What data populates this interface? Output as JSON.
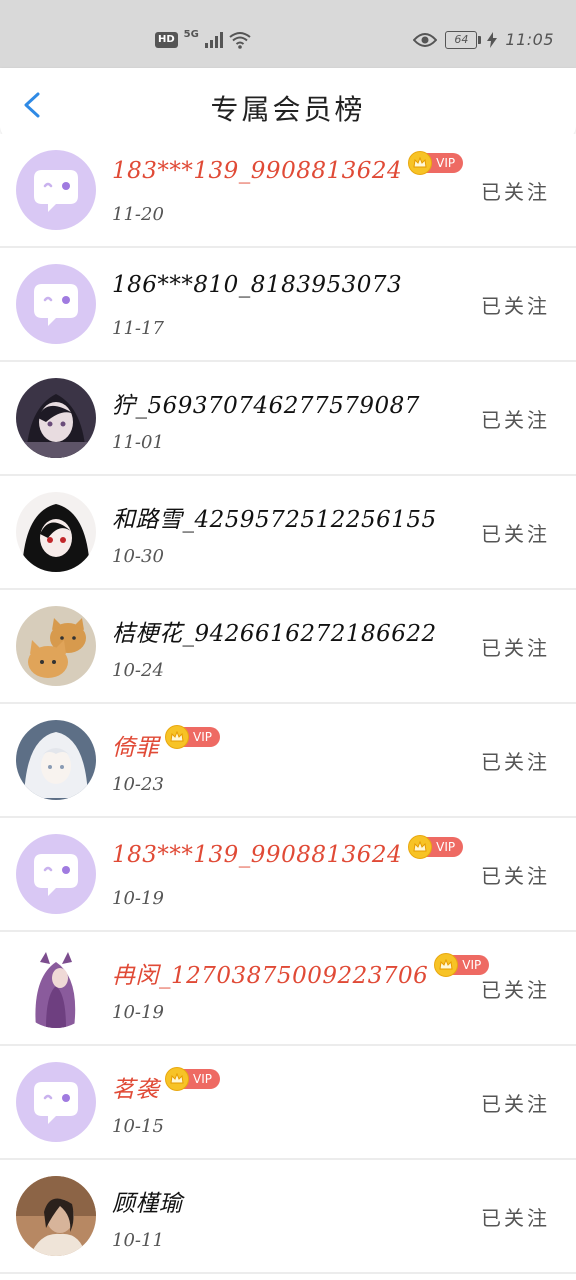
{
  "status_bar": {
    "hd": "HD",
    "net": "5G",
    "battery": "64",
    "time": "11:05"
  },
  "header": {
    "title": "专属会员榜"
  },
  "vip_label": "VIP",
  "follow_label": "已关注",
  "members": [
    {
      "name": "183***139_9908813624",
      "date": "11-20",
      "vip": true,
      "avatar": "chat"
    },
    {
      "name": "186***810_8183953073",
      "date": "11-17",
      "vip": false,
      "avatar": "chat"
    },
    {
      "name": "狞_5693707462775790​87",
      "date": "11-01",
      "vip": false,
      "avatar": "anime-dark"
    },
    {
      "name": "和路雪_4259572512256155",
      "date": "10-30",
      "vip": false,
      "avatar": "anime-red"
    },
    {
      "name": "桔梗花_9426616272186622",
      "date": "10-24",
      "vip": false,
      "avatar": "cats"
    },
    {
      "name": "倚罪",
      "date": "10-23",
      "vip": true,
      "avatar": "anime-white"
    },
    {
      "name": "183***139_9908813624",
      "date": "10-19",
      "vip": true,
      "avatar": "chat"
    },
    {
      "name": "冉闵_12703875009223706",
      "date": "10-19",
      "vip": true,
      "avatar": "purple-hair"
    },
    {
      "name": "茗袭",
      "date": "10-15",
      "vip": true,
      "avatar": "chat"
    },
    {
      "name": "顾槿瑜",
      "date": "10-11",
      "vip": false,
      "avatar": "photo"
    }
  ],
  "colors": {
    "vip_name": "#e04a36",
    "vip_badge": "#ee6a63",
    "crown": "#f7c326",
    "chat_avatar": "#d9c8f4"
  }
}
